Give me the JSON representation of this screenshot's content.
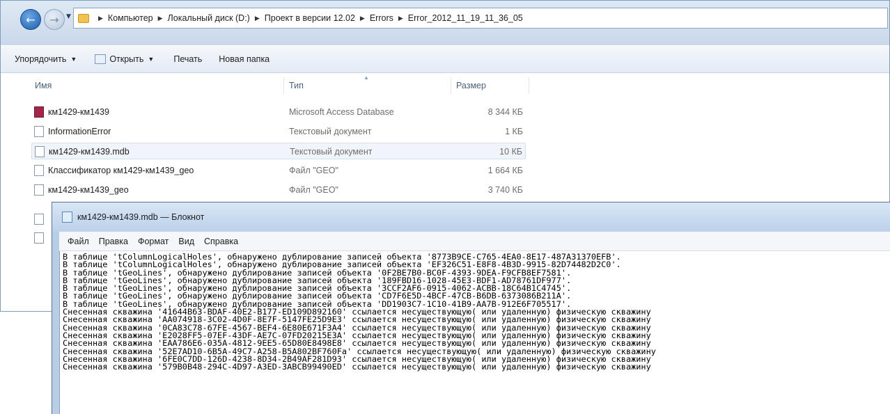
{
  "explorer": {
    "breadcrumb": [
      "Компьютер",
      "Локальный диск (D:)",
      "Проект в версии 12.02",
      "Errors",
      "Error_2012_11_19_11_36_05"
    ],
    "toolbar": {
      "organize": "Упорядочить",
      "open": "Открыть",
      "print": "Печать",
      "new_folder": "Новая папка"
    },
    "columns": {
      "name": "Имя",
      "type": "Тип",
      "size": "Размер"
    },
    "files": [
      {
        "name": "км1429-км1439",
        "type": "Microsoft Access Database",
        "size": "8 344 КБ",
        "icon": "access-database-icon"
      },
      {
        "name": "InformationError",
        "type": "Текстовый документ",
        "size": "1 КБ",
        "icon": "text-file-icon"
      },
      {
        "name": "км1429-км1439.mdb",
        "type": "Текстовый документ",
        "size": "10 КБ",
        "icon": "text-file-icon"
      },
      {
        "name": "Классификатор км1429-км1439_geo",
        "type": "Файл \"GEO\"",
        "size": "1 664 КБ",
        "icon": "file-icon"
      },
      {
        "name": "км1429-км1439_geo",
        "type": "Файл \"GEO\"",
        "size": "3 740 КБ",
        "icon": "file-icon"
      }
    ]
  },
  "notepad": {
    "title": "км1429-км1439.mdb — Блокнот",
    "menu": [
      "Файл",
      "Правка",
      "Формат",
      "Вид",
      "Справка"
    ],
    "lines": [
      "В таблице 'tColumnLogicalHoles', обнаружено дублирование записей объекта '8773B9CE-C765-4EA0-8E17-487A31370EFB'.",
      "В таблице 'tColumnLogicalHoles', обнаружено дублирование записей объекта 'EF326C51-E8F8-4B3D-9915-82D74482D2C0'.",
      "В таблице 'tGeoLines', обнаружено дублирование записей объекта '0F2BE7B0-BC0F-4393-9DEA-F9CFB8EF7581'.",
      "В таблице 'tGeoLines', обнаружено дублирование записей объекта '189FBD16-1028-45E3-BDF1-AD78761DF977'.",
      "В таблице 'tGeoLines', обнаружено дублирование записей объекта '3CCF2AF6-0915-4062-ACBB-18C64B1C4745'.",
      "В таблице 'tGeoLines', обнаружено дублирование записей объекта 'CD7F6E5D-4BCF-47CB-B6DB-6373086B211A'.",
      "В таблице 'tGeoLines', обнаружено дублирование записей объекта 'DD1903C7-1C10-41B9-AA7B-912E6F705517'.",
      "Снесенная скважина '41644B63-BDAF-40E2-B177-ED109D892160' ссылается несуществующую( или удаленную) физическую скважину",
      "Снесенная скважина 'AA074918-3C02-4D0F-8E7F-5147FE25D9E3' ссылается несуществующую( или удаленную) физическую скважину",
      "Снесенная скважина '0CA83C78-67FE-4567-BEF4-6E80E671F3A4' ссылается несуществующую( или удаленную) физическую скважину",
      "Снесенная скважина 'E2028FF5-07EF-43DF-AE7C-07FD20215E3A' ссылается несуществующую( или удаленную) физическую скважину",
      "Снесенная скважина 'EAA786E6-035A-4812-9EE5-65D80E8498E8' ссылается несуществующую( или удаленную) физическую скважину",
      "Снесенная скважина '52E7AD10-6B5A-49C7-A258-B5A802BF760Fa' ссылается несуществующую( или удаленную) физическую скважину",
      "Снесенная скважина '6FE0C7DD-126D-4238-8D34-2B49AF281D93' ссылается несуществующую( или удаленную) физическую скважину",
      "Снесенная скважина '579B0B48-294C-4D97-A3ED-3ABCB99490ED' ссылается несуществующую( или удаленную) физическую скважину"
    ]
  }
}
